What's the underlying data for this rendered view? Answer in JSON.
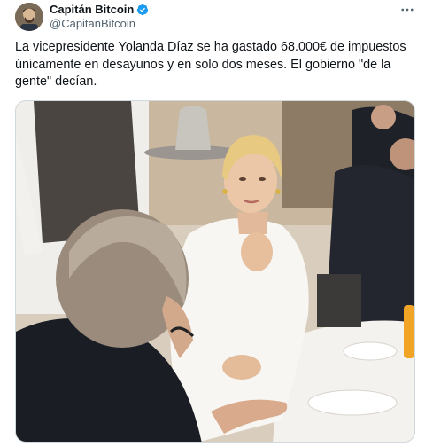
{
  "tweet": {
    "author": {
      "name": "Capitán Bitcoin",
      "handle": "@CapitanBitcoin",
      "verified": true,
      "avatar_icon": "bitcoin-avatar-icon"
    },
    "more_icon": "ellipsis-icon",
    "text": "La vicepresidente Yolanda Díaz se ha gastado 68.000€ de impuestos únicamente en desayunos y en solo dos meses. El gobierno \"de la gente\" decían.",
    "colors": {
      "verified_badge": "#1d9bf0",
      "handle": "#536471",
      "text": "#0f1419"
    }
  }
}
